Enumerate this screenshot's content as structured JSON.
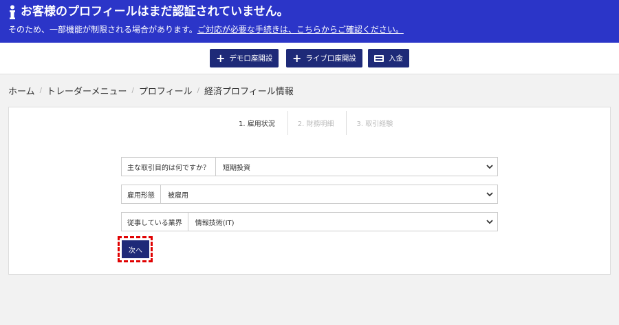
{
  "notice": {
    "icon": "info-icon",
    "title": "お客様のプロフィールはまだ認証されていません。",
    "text": "そのため、一部機能が制限される場合があります。",
    "link": "ご対応が必要な手続きは、こちらからご確認ください。",
    "bg_color": "#2b35c8"
  },
  "topbar": {
    "demo": "デモ口座開設",
    "live": "ライブ口座開設",
    "deposit": "入金",
    "button_color": "#1e2a78"
  },
  "breadcrumb": {
    "items": [
      "ホーム",
      "トレーダーメニュー",
      "プロフィール",
      "経済プロフィール情報"
    ],
    "sep": "/"
  },
  "steps": [
    "1. 雇用状況",
    "2. 財務明細",
    "3. 取引経験"
  ],
  "form": {
    "purpose": {
      "label": "主な取引目的は何ですか？",
      "value": "短期投資"
    },
    "employment": {
      "label": "雇用形態",
      "value": "被雇用"
    },
    "industry": {
      "label": "従事している業界",
      "value": "情報技術(IT)"
    },
    "next": "次へ"
  }
}
